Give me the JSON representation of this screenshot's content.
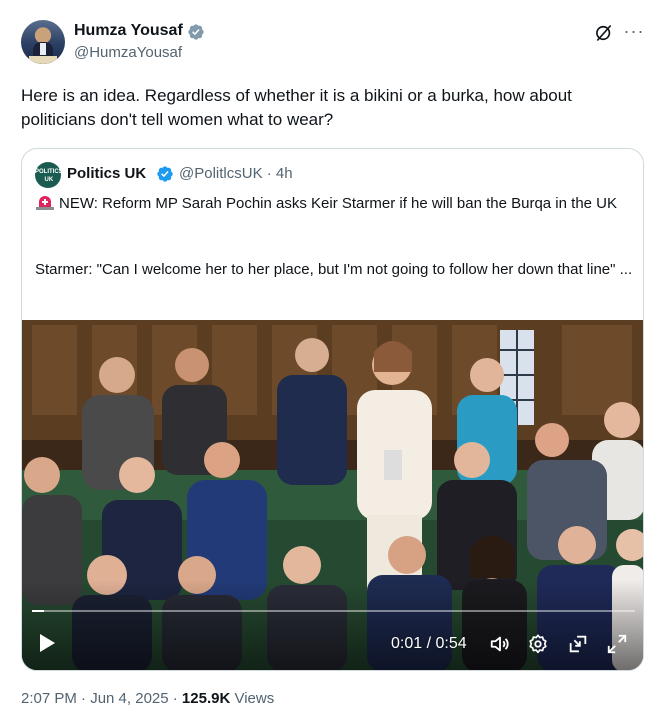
{
  "author": {
    "name": "Humza Yousaf",
    "handle": "@HumzaYousaf",
    "verified_color": "#829aab"
  },
  "tweet": {
    "text": "Here is an idea. Regardless of whether it is a bikini or a burka, how about politicians don't tell women what to wear?"
  },
  "quoted": {
    "avatar_text": "POLITICS UK",
    "name": "Politics UK",
    "handle_time": "@PolitlcsUK · 4h",
    "verified_color": "#1d9bf0",
    "line1": "NEW: Reform MP Sarah Pochin asks Keir Starmer if he will ban the Burqa in the UK",
    "line2": "Starmer: \"Can I welcome her to her place, but I'm not going to follow her down that line\" ..."
  },
  "video": {
    "time": "0:01 / 0:54",
    "progress": 0.02
  },
  "meta": {
    "timestamp": "2:07 PM · Jun 4, 2025 · ",
    "views_count": "125.9K",
    "views_label": " Views"
  },
  "icons": {
    "grok": "grok-icon",
    "more": "more-icon",
    "play": "play-icon",
    "volume": "volume-icon",
    "settings": "settings-icon",
    "pip": "picture-in-picture-icon",
    "fullscreen": "fullscreen-icon"
  }
}
